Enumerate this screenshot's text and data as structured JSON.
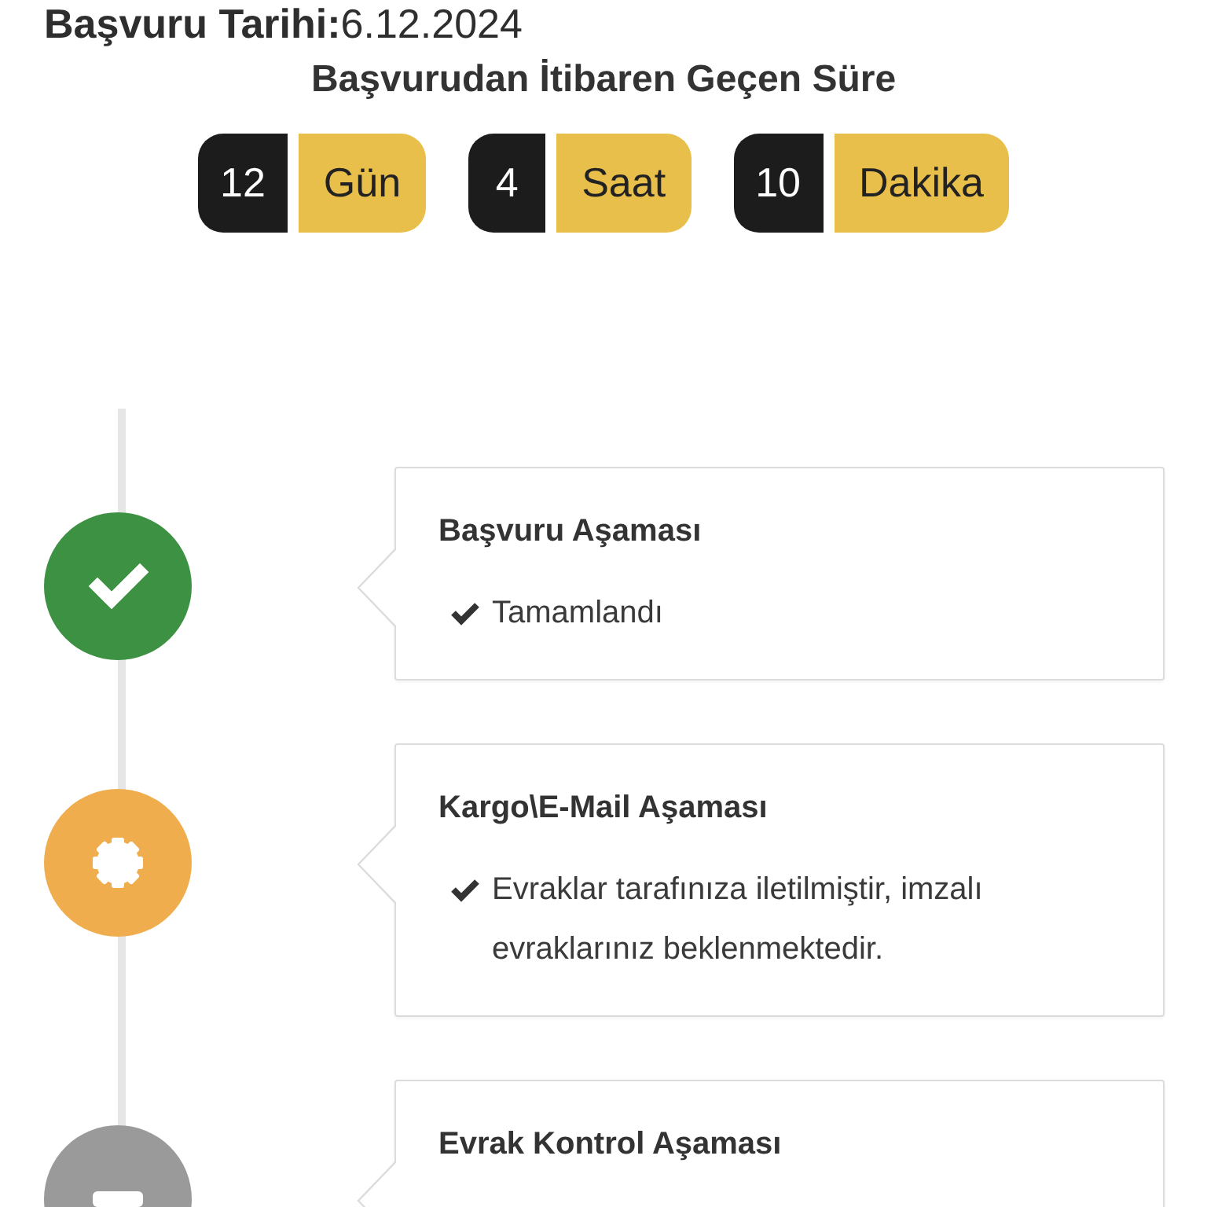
{
  "application_date": "**Başvuru Tarihi:**6.12.2024",
  "elapsed": {
    "title": "Başvurudan İtibaren Geçen Süre",
    "units": [
      {
        "value": "12",
        "unit": "Gün"
      },
      {
        "value": "4",
        "unit": "Saat"
      },
      {
        "value": "10",
        "unit": "Dakika"
      }
    ]
  },
  "steps": [
    {
      "kind": "done",
      "title": "Başvuru Aşaması",
      "note": "Tamamlandı"
    },
    {
      "kind": "active",
      "title": "Kargo\\E-Mail Aşaması",
      "note": "Evraklar tarafınıza iletilmiştir, imzalı evraklarınız beklenmektedir."
    },
    {
      "kind": "pending",
      "title": "Evrak Kontrol Aşaması"
    }
  ]
}
